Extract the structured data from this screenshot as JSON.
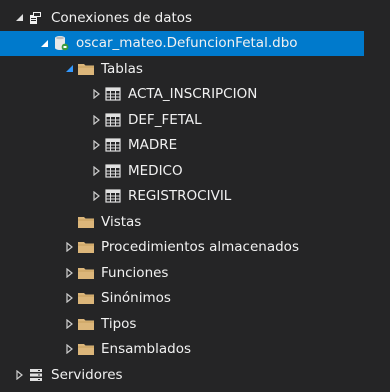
{
  "tree": {
    "root": {
      "label": "Conexiones de datos",
      "expanded": true,
      "icon": "data-connections-icon"
    },
    "connection": {
      "label": "oscar_mateo.DefuncionFetal.dbo",
      "expanded": true,
      "selected": true,
      "icon": "database-connection-icon"
    },
    "folders": [
      {
        "label": "Tablas",
        "expanded": true,
        "icon": "folder-icon"
      },
      {
        "label": "Vistas",
        "expanded": false,
        "has_children": false,
        "icon": "folder-icon"
      },
      {
        "label": "Procedimientos almacenados",
        "expanded": false,
        "icon": "folder-icon"
      },
      {
        "label": "Funciones",
        "expanded": false,
        "icon": "folder-icon"
      },
      {
        "label": "Sinónimos",
        "expanded": false,
        "icon": "folder-icon"
      },
      {
        "label": "Tipos",
        "expanded": false,
        "icon": "folder-icon"
      },
      {
        "label": "Ensamblados",
        "expanded": false,
        "icon": "folder-icon"
      }
    ],
    "tables": [
      {
        "label": "ACTA_INSCRIPCION",
        "icon": "table-icon"
      },
      {
        "label": "DEF_FETAL",
        "icon": "table-icon"
      },
      {
        "label": "MADRE",
        "icon": "table-icon"
      },
      {
        "label": "MEDICO",
        "icon": "table-icon"
      },
      {
        "label": "REGISTROCIVIL",
        "icon": "table-icon"
      }
    ],
    "servers": {
      "label": "Servidores",
      "expanded": false,
      "icon": "servers-icon"
    }
  },
  "colors": {
    "background": "#252526",
    "selection": "#007acc",
    "text": "#f1f1f1",
    "folder": "#dcb67a",
    "arrow": "#cccccc"
  }
}
